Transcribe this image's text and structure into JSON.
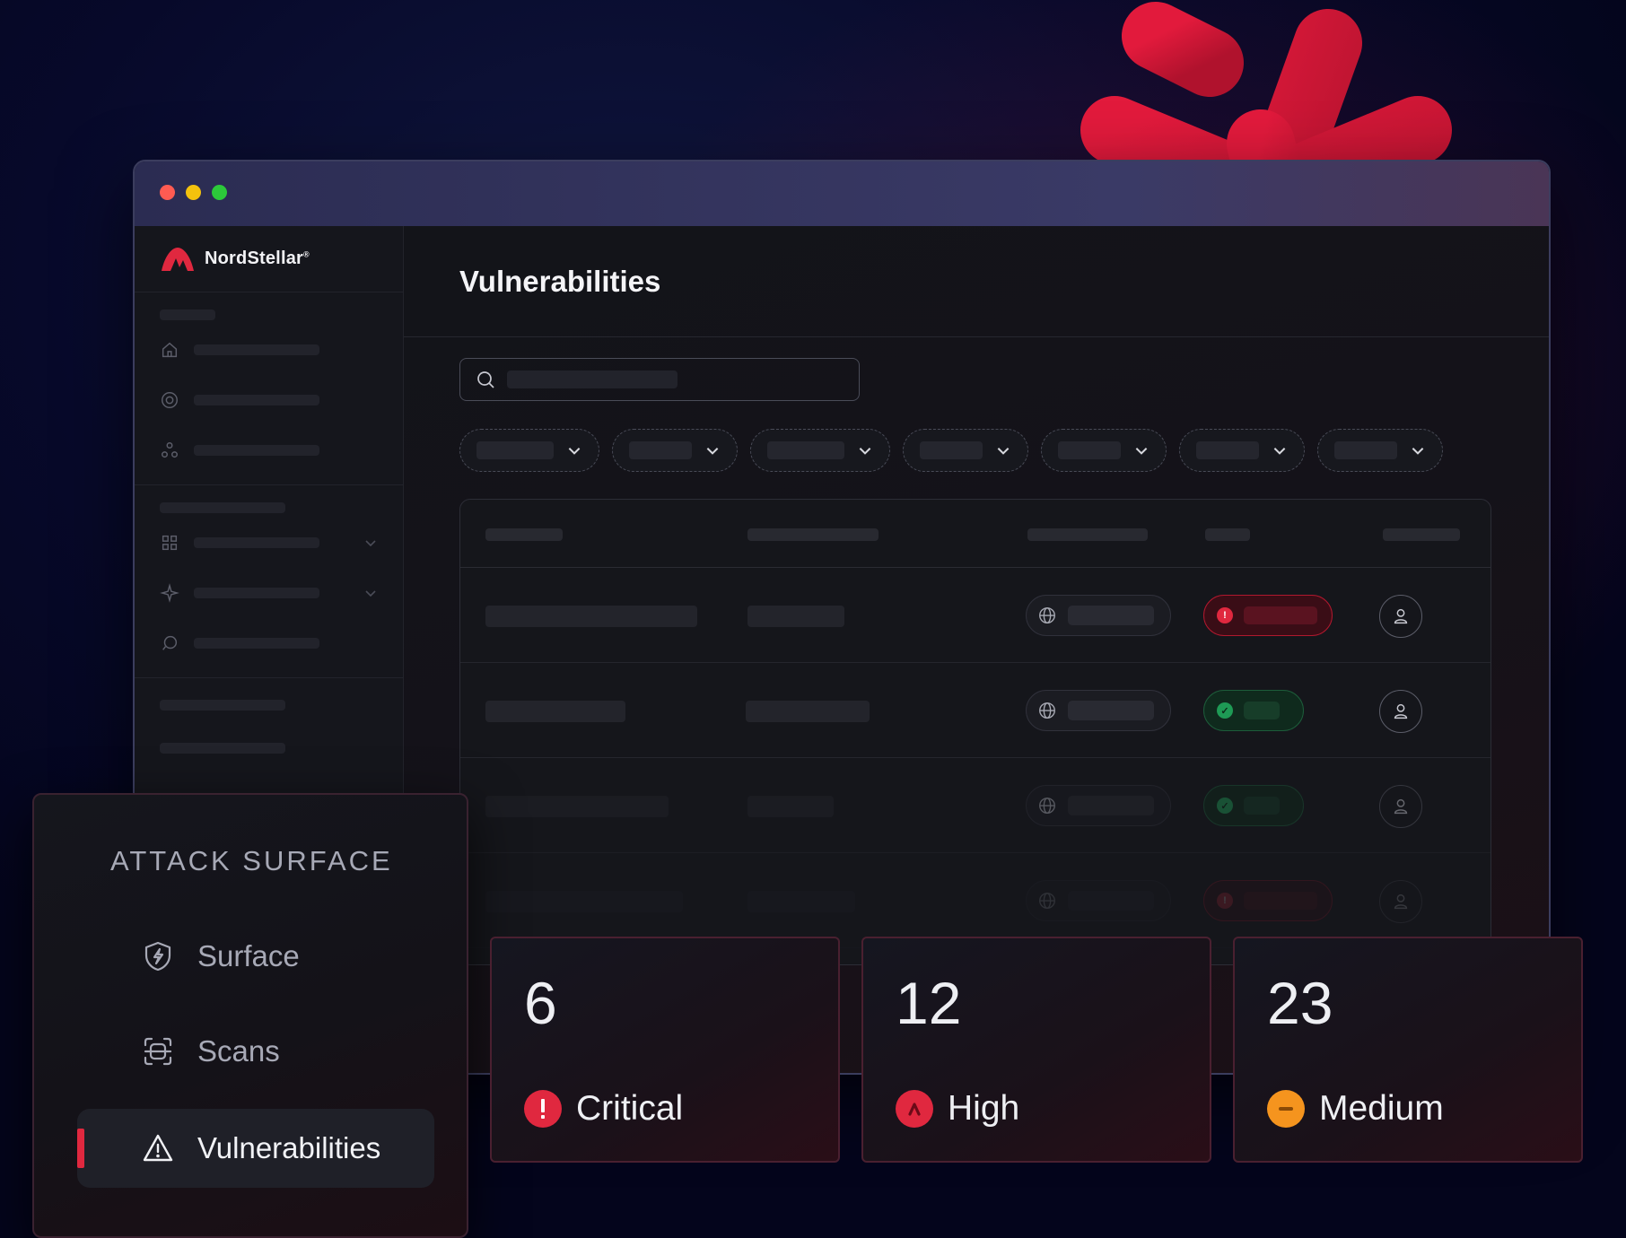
{
  "window": {
    "brand": "NordStellar",
    "brand_mark": "®",
    "page_title": "Vulnerabilities"
  },
  "menu": {
    "section_title": "ATTACK SURFACE",
    "items": [
      {
        "label": "Surface",
        "icon": "shield-bolt-icon",
        "active": false
      },
      {
        "label": "Scans",
        "icon": "scan-icon",
        "active": false
      },
      {
        "label": "Vulnerabilities",
        "icon": "warning-triangle-icon",
        "active": true
      }
    ]
  },
  "stats": [
    {
      "count": "6",
      "label": "Critical",
      "icon": "exclamation-icon",
      "color": "#e0283f"
    },
    {
      "count": "12",
      "label": "High",
      "icon": "caret-up-icon",
      "color": "#e0283f"
    },
    {
      "count": "23",
      "label": "Medium",
      "icon": "minus-icon",
      "color": "#f5941e"
    }
  ],
  "colors": {
    "accent": "#e0283f",
    "medium": "#f5941e",
    "ok": "#1e9a55",
    "background": "#07092a"
  }
}
